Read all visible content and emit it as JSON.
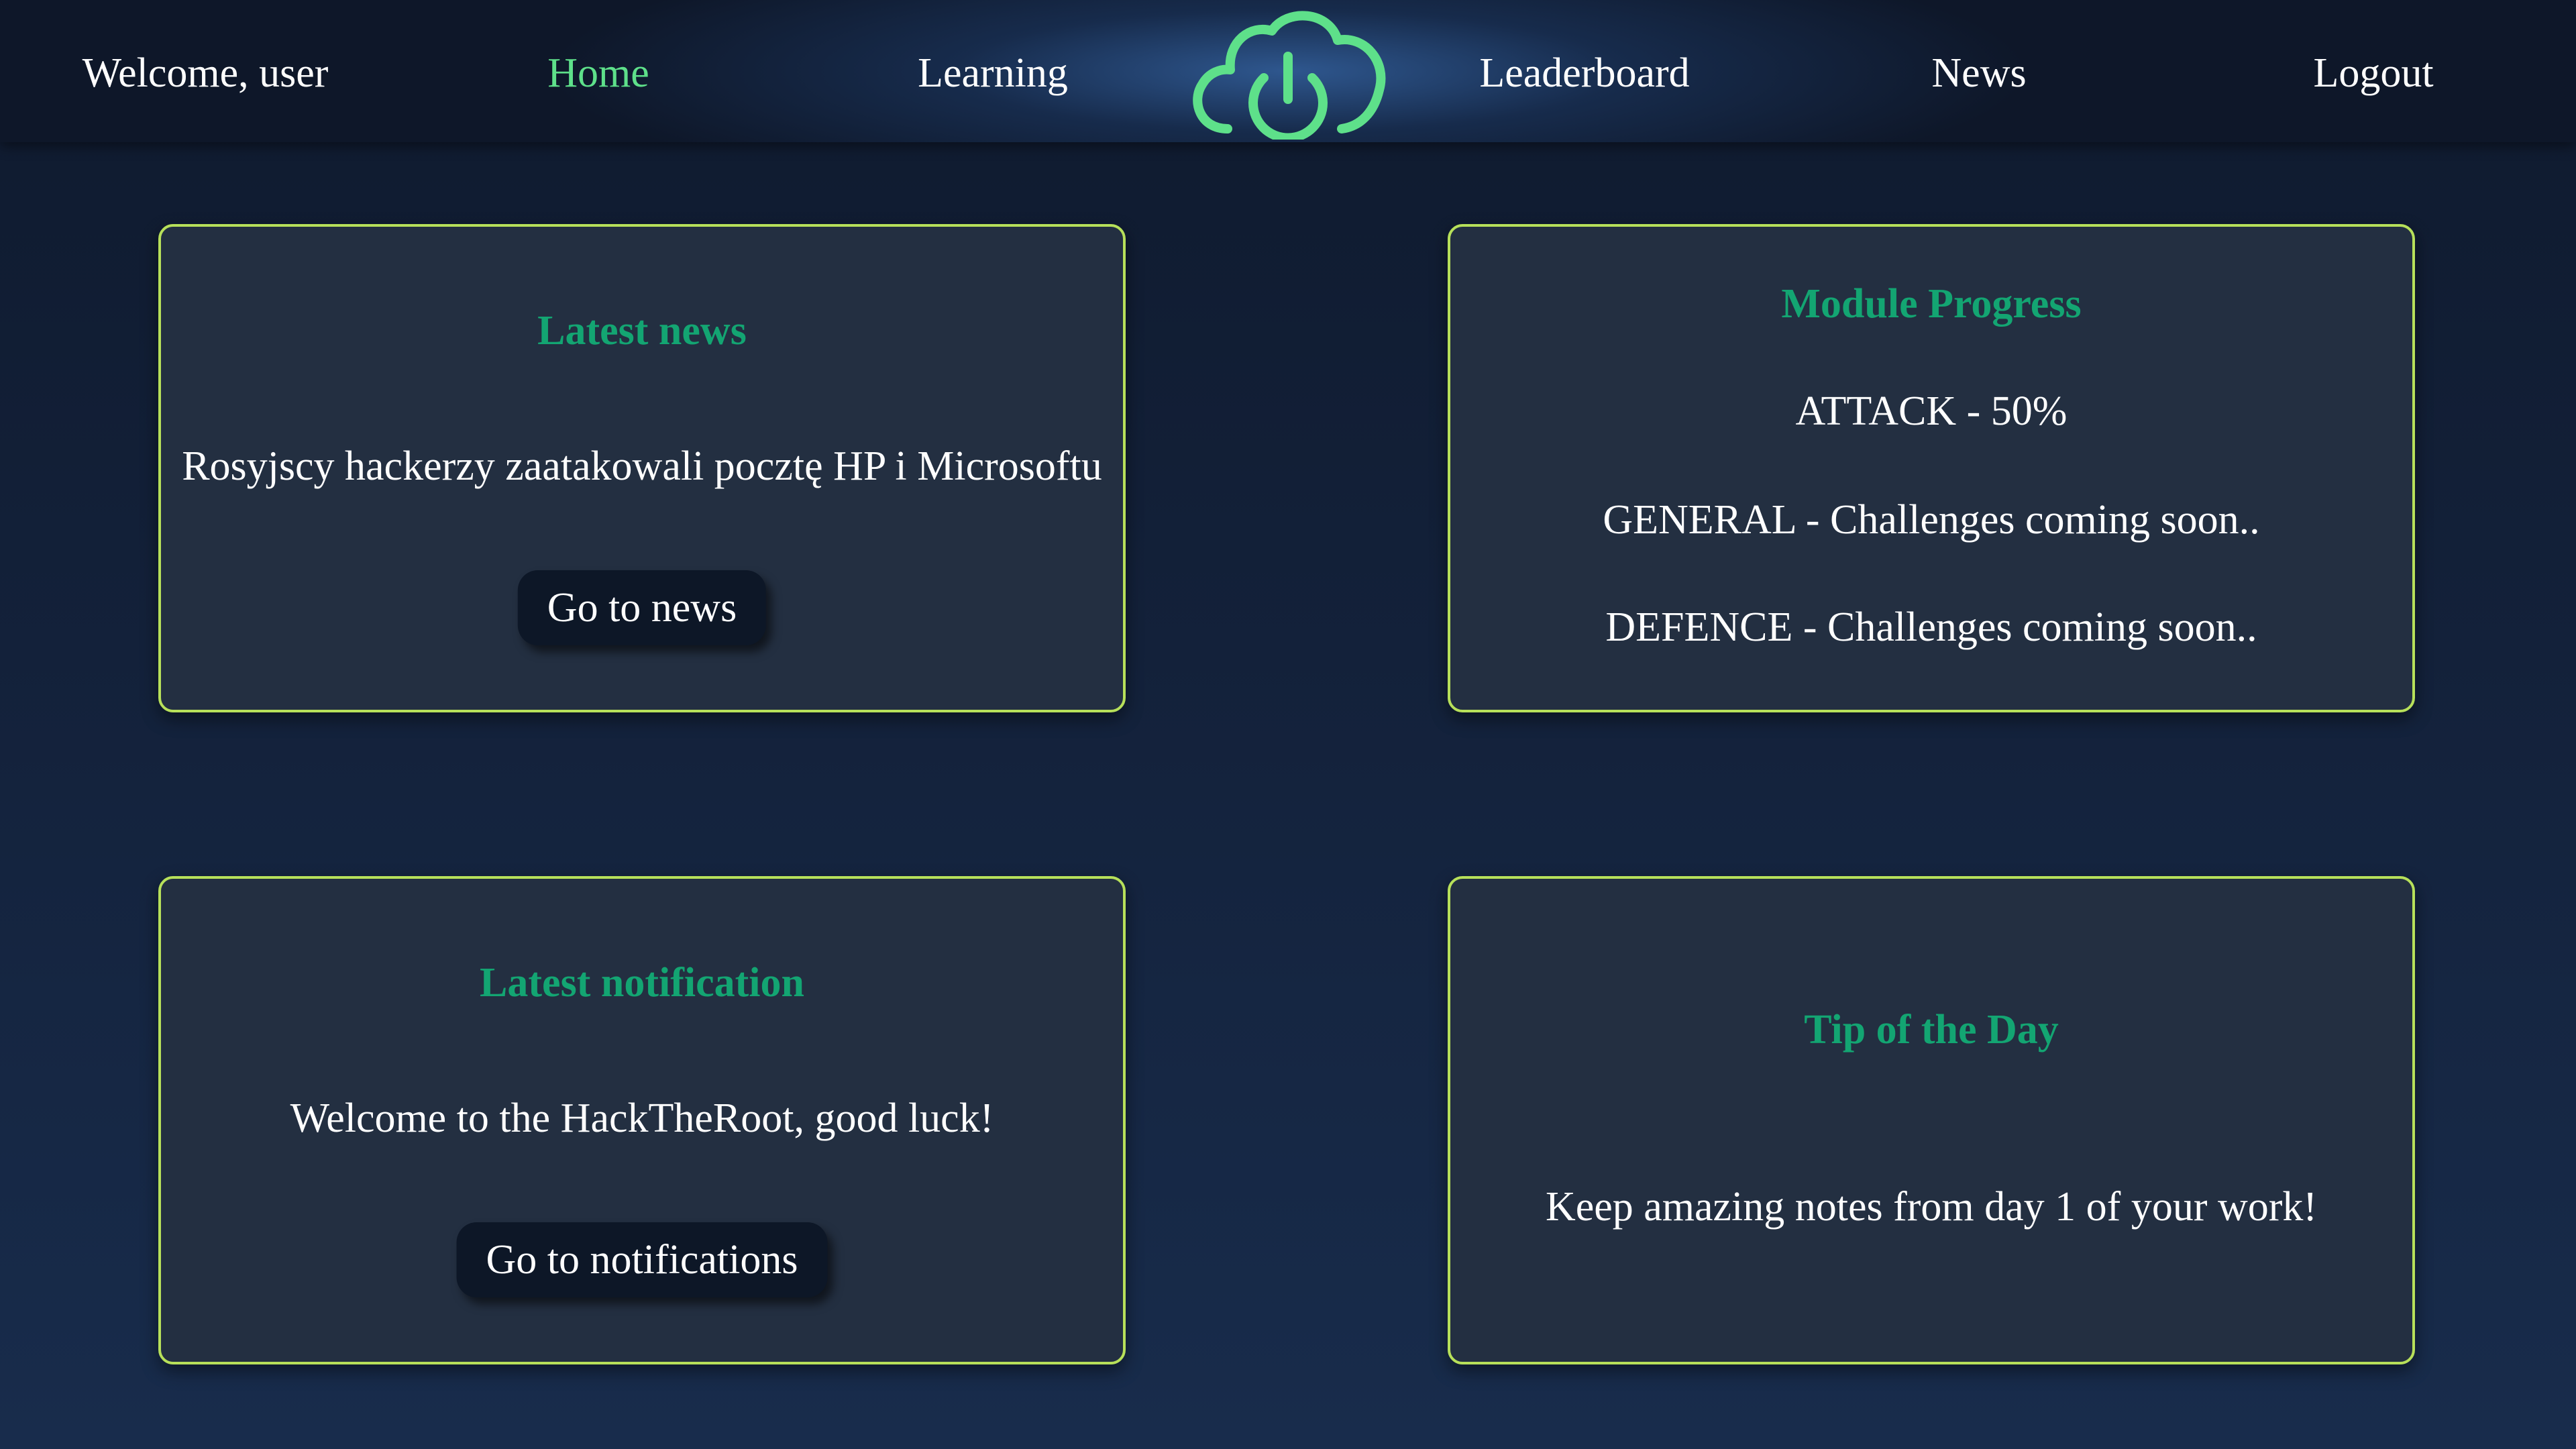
{
  "nav": {
    "welcome": "Welcome, user",
    "home": "Home",
    "learning": "Learning",
    "leaderboard": "Leaderboard",
    "news": "News",
    "logout": "Logout",
    "logo_icon": "cloud-power-icon",
    "accent_color": "#5ee08a"
  },
  "news_card": {
    "title": "Latest news",
    "text": "Rosyjscy hackerzy zaatakowali pocztę HP i Microsoftu",
    "button": "Go to news"
  },
  "progress_card": {
    "title": "Module Progress",
    "modules": [
      "ATTACK - 50%",
      "GENERAL - Challenges coming soon..",
      "DEFENCE - Challenges coming soon.."
    ]
  },
  "notification_card": {
    "title": "Latest notification",
    "text": "Welcome to the HackTheRoot, good luck!",
    "button": "Go to notifications"
  },
  "tip_card": {
    "title": "Tip of the Day",
    "text": "Keep amazing notes from day 1 of your work!"
  },
  "colors": {
    "card_border": "#b7e05a",
    "card_title": "#13a572",
    "card_bg": "#232f41"
  }
}
